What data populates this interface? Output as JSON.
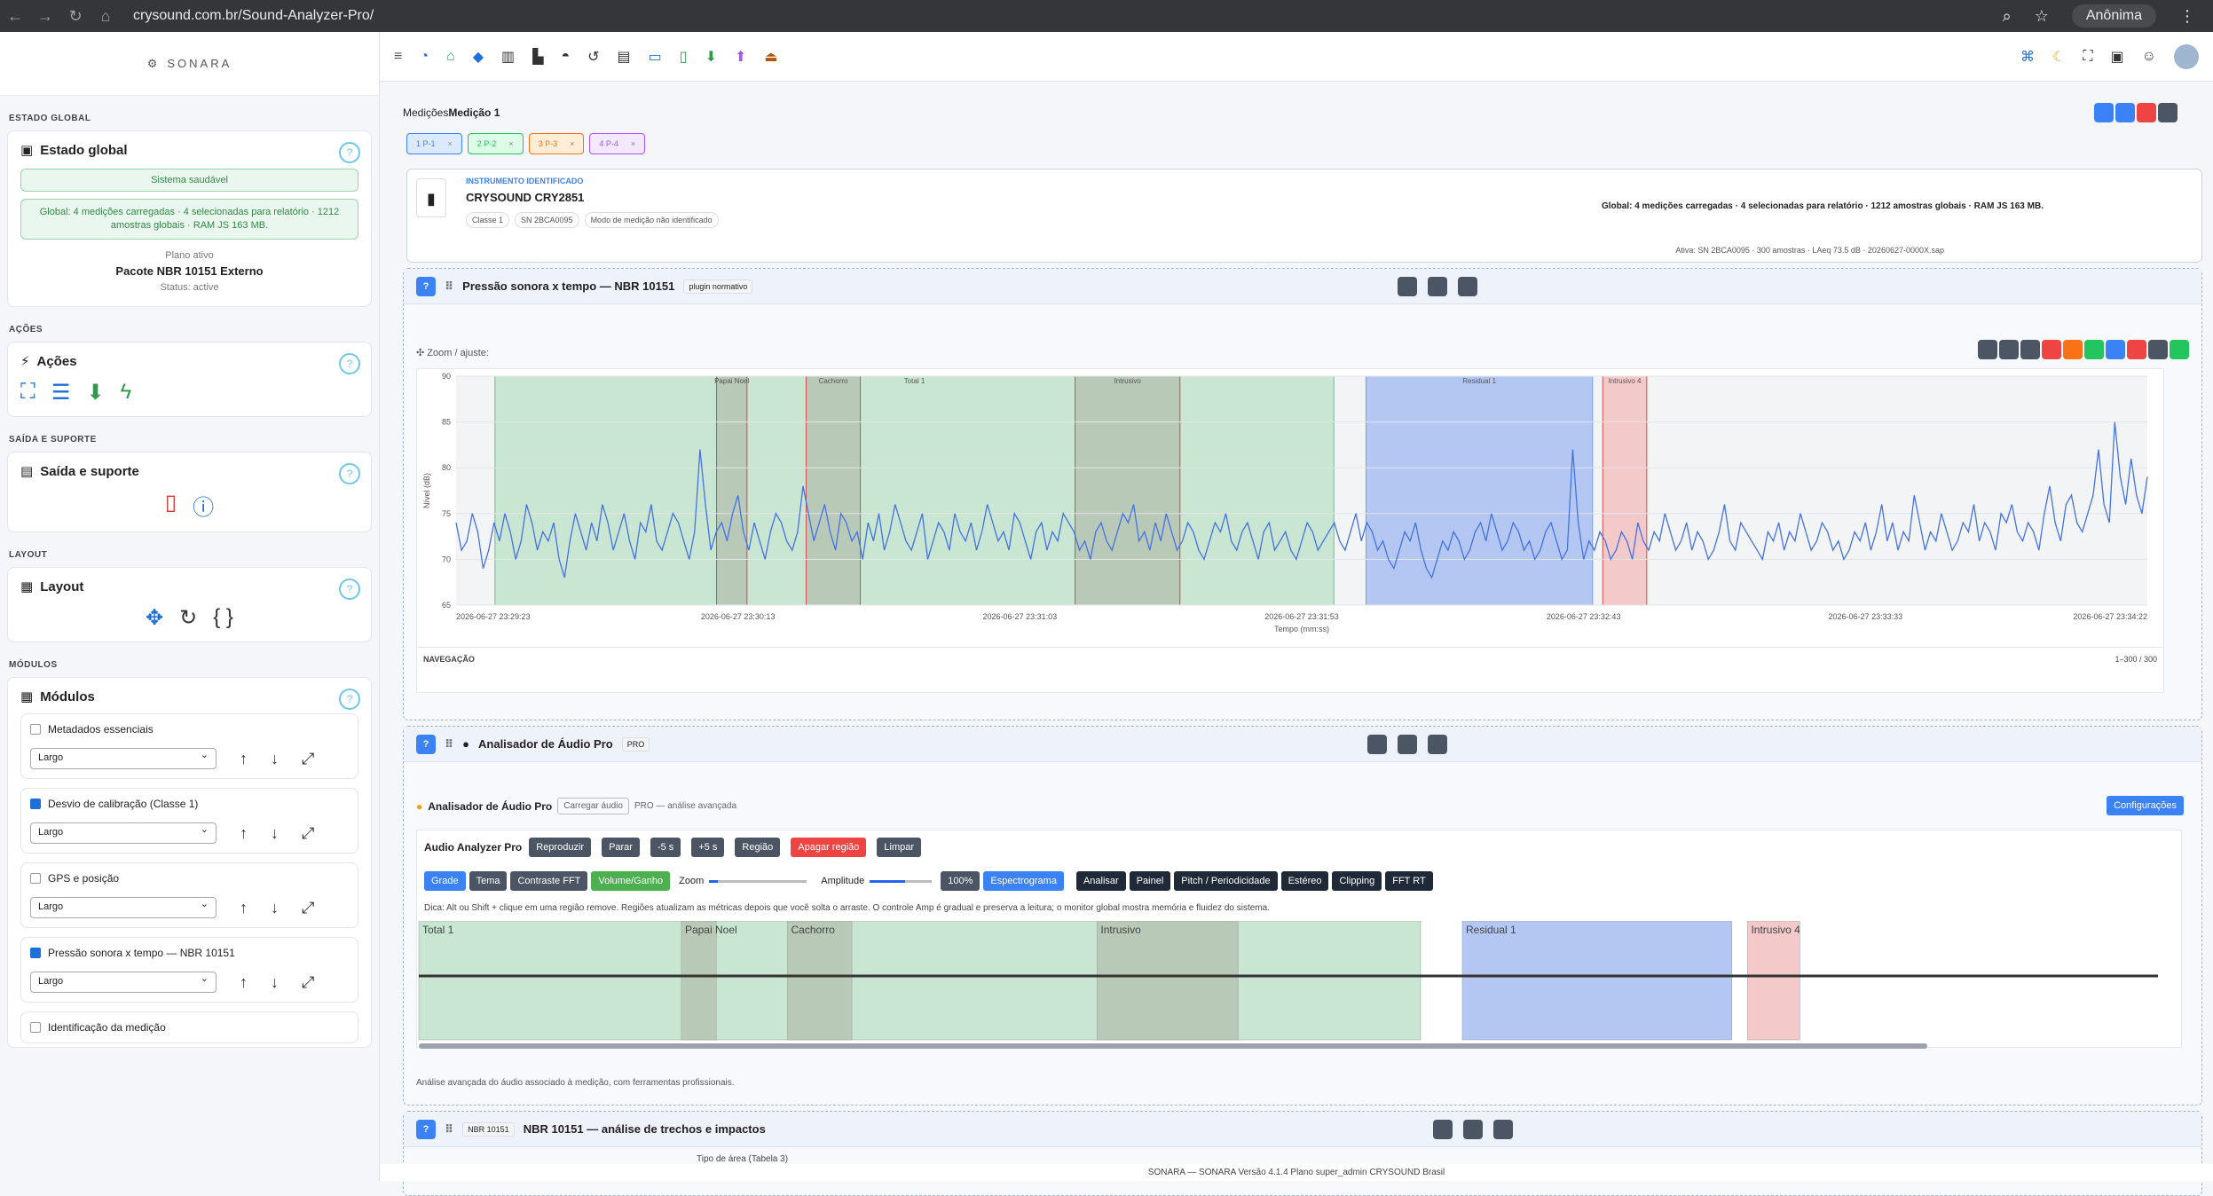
{
  "browser": {
    "url": "crysound.com.br/Sound-Analyzer-Pro/",
    "profile": "Anônima"
  },
  "brand": "SONARA",
  "sidebar": {
    "estado_title": "ESTADO GLOBAL",
    "estado_card": "Estado global",
    "healthy": "Sistema saudável",
    "global_info": "Global: 4 medições carregadas · 4 selecionadas para relatório · 1212 amostras globais · RAM JS 163 MB.",
    "plan_label": "Plano ativo",
    "plan_name": "Pacote NBR 10151 Externo",
    "plan_status": "Status: active",
    "acoes_title": "AÇÕES",
    "acoes_card": "Ações",
    "saida_title": "SAÍDA E SUPORTE",
    "saida_card": "Saída e suporte",
    "layout_title": "LAYOUT",
    "layout_card": "Layout",
    "modulos_title": "MÓDULOS",
    "modulos_card": "Módulos",
    "modules": [
      {
        "label": "Metadados essenciais",
        "checked": false,
        "size": "Largo"
      },
      {
        "label": "Desvio de calibração (Classe 1)",
        "checked": true,
        "size": "Largo"
      },
      {
        "label": "GPS e posição",
        "checked": false,
        "size": "Largo"
      },
      {
        "label": "Pressão sonora x tempo — NBR 10151",
        "checked": true,
        "size": "Largo"
      },
      {
        "label": "Identificação da medição",
        "checked": false,
        "size": ""
      }
    ]
  },
  "measurements": {
    "label": "Medições",
    "current": "Medição 1",
    "tabs": [
      "1  P-1",
      "2  P-2",
      "3  P-3",
      "4  P-4"
    ]
  },
  "instrument": {
    "kicker": "INSTRUMENTO IDENTIFICADO",
    "name": "CRYSOUND CRY2851",
    "chips": [
      "Classe 1",
      "SN 2BCA0095",
      "Modo de medição não identificado"
    ],
    "global": "Global: 4 medições carregadas · 4 selecionadas para relatório · 1212 amostras globais · RAM JS 163 MB.",
    "active": "Ativa: SN 2BCA0095 · 300 amostras · LAeq 73.5 dB · 20260627-0000X.sap"
  },
  "chart_panel": {
    "title": "Pressão sonora x tempo — NBR 10151",
    "tag": "plugin normativo",
    "zoom": "Zoom / ajuste:",
    "nav": "NAVEGAÇÃO",
    "range": "1–300 / 300"
  },
  "chart_data": {
    "type": "line",
    "xlabel": "Tempo (mm:ss)",
    "ylabel": "Nível (dB)",
    "ylim": [
      65,
      90
    ],
    "yticks": [
      "90",
      "85",
      "80",
      "75",
      "70",
      "65"
    ],
    "xticks": [
      "2026-06-27 23:29:23",
      "2026-06-27 23:30:13",
      "2026-06-27 23:31:03",
      "2026-06-27 23:31:53",
      "2026-06-27 23:32:43",
      "2026-06-27 23:33:33",
      "2026-06-27 23:34:22"
    ],
    "regions": [
      {
        "name": "Total 1",
        "from": 0.023,
        "to": 0.519,
        "color": "#c8e6d1"
      },
      {
        "name": "Papai Noel",
        "from": 0.154,
        "to": 0.172,
        "color": "#b9c9b8"
      },
      {
        "name": "Cachorro",
        "from": 0.207,
        "to": 0.239,
        "color": "#b9c9b8"
      },
      {
        "name": "Intrusivo",
        "from": 0.366,
        "to": 0.428,
        "color": "#b9c9b8"
      },
      {
        "name": "Residual 1",
        "from": 0.538,
        "to": 0.672,
        "color": "#b3c7f2"
      },
      {
        "name": "Intrusivo 4",
        "from": 0.678,
        "to": 0.704,
        "color": "#f3c9c9"
      }
    ],
    "series": [
      {
        "values": [
          74,
          71,
          72,
          75,
          73,
          69,
          71,
          74,
          72,
          75,
          73,
          70,
          72,
          76,
          74,
          71,
          73,
          72,
          74,
          70,
          68,
          72,
          75,
          73,
          71,
          74,
          72,
          76,
          74,
          71,
          73,
          75,
          72,
          70,
          74,
          73,
          76,
          72,
          71,
          73,
          75,
          74,
          72,
          70,
          73,
          82,
          76,
          71,
          73,
          74,
          72,
          75,
          77,
          73,
          71,
          74,
          72,
          70,
          73,
          75,
          74,
          72,
          71,
          73,
          78,
          75,
          72,
          74,
          76,
          73,
          71,
          75,
          74,
          72,
          73,
          70,
          74,
          72,
          75,
          71,
          73,
          76,
          74,
          72,
          71,
          73,
          75,
          70,
          72,
          74,
          73,
          71,
          75,
          73,
          72,
          74,
          71,
          73,
          76,
          74,
          72,
          73,
          71,
          75,
          74,
          72,
          70,
          73,
          74,
          71,
          73,
          72,
          75,
          74,
          73,
          71,
          72,
          70,
          73,
          74,
          72,
          71,
          73,
          75,
          74,
          76,
          72,
          73,
          71,
          74,
          72,
          75,
          73,
          71,
          72,
          74,
          73,
          71,
          70,
          72,
          74,
          73,
          75,
          72,
          71,
          73,
          74,
          72,
          70,
          73,
          74,
          71,
          72,
          73,
          71,
          70,
          72,
          74,
          73,
          71,
          72,
          73,
          74,
          72,
          71,
          73,
          75,
          72,
          74,
          73,
          71,
          72,
          70,
          69,
          71,
          73,
          72,
          74,
          71,
          69,
          68,
          70,
          72,
          71,
          73,
          72,
          70,
          71,
          73,
          74,
          72,
          75,
          73,
          71,
          72,
          74,
          73,
          71,
          72,
          70,
          71,
          73,
          74,
          72,
          70,
          71,
          82,
          74,
          70,
          72,
          71,
          73,
          72,
          70,
          71,
          73,
          72,
          70,
          74,
          72,
          71,
          73,
          72,
          75,
          73,
          71,
          72,
          74,
          71,
          73,
          72,
          70,
          71,
          73,
          76,
          72,
          71,
          74,
          73,
          72,
          71,
          70,
          73,
          72,
          74,
          71,
          73,
          72,
          75,
          73,
          71,
          72,
          74,
          73,
          71,
          72,
          70,
          71,
          73,
          72,
          74,
          71,
          73,
          76,
          72,
          74,
          71,
          73,
          72,
          77,
          74,
          71,
          73,
          72,
          75,
          73,
          71,
          72,
          74,
          73,
          76,
          72,
          74,
          73,
          71,
          75,
          74,
          76,
          73,
          72,
          74,
          73,
          71,
          75,
          78,
          74,
          72,
          76,
          77,
          74,
          73,
          75,
          77,
          82,
          76,
          74,
          85,
          79,
          76,
          81,
          77,
          75,
          79
        ]
      }
    ]
  },
  "audio_panel": {
    "title": "Analisador de Áudio Pro",
    "tag": "PRO",
    "sub": "Analisador de Áudio Pro",
    "load": "Carregar áudio",
    "pro": "PRO — análise avançada",
    "config": "Configurações",
    "toolbar_title": "Audio Analyzer Pro",
    "btns1": [
      "Reproduzir",
      "Parar",
      "-5 s",
      "+5 s",
      "Região",
      "Apagar região",
      "Limpar"
    ],
    "btns2": [
      "Grade",
      "Tema",
      "Contraste FFT",
      "Volume/Ganho"
    ],
    "zoom": "Zoom",
    "amp": "Amplitude",
    "pct": "100%",
    "spec": "Espectrograma",
    "btns3": [
      "Analisar",
      "Painel",
      "Pitch / Periodicidade",
      "Estéreo",
      "Clipping",
      "FFT RT"
    ],
    "tip": "Dica: Alt ou Shift + clique em uma região remove. Regiões atualizam as métricas depois que você solta o arraste. O controle Amp é gradual e preserva a leitura; o monitor global mostra memória e fluidez do sistema.",
    "wave_regions": [
      "Total 1",
      "Papai Noel",
      "Cachorro",
      "Intrusivo",
      "Residual 1",
      "Intrusivo 4"
    ],
    "caption": "Análise avançada do áudio associado à medição, com ferramentas profissionais."
  },
  "nbr_panel": {
    "title": "NBR 10151 — análise de trechos e impactos",
    "tag": "NBR 10151",
    "sub": "Tipo de área (Tabela 3)"
  },
  "footer": "SONARA — SONARA  Versão 4.1.4  Plano super_admin  CRYSOUND Brasil"
}
